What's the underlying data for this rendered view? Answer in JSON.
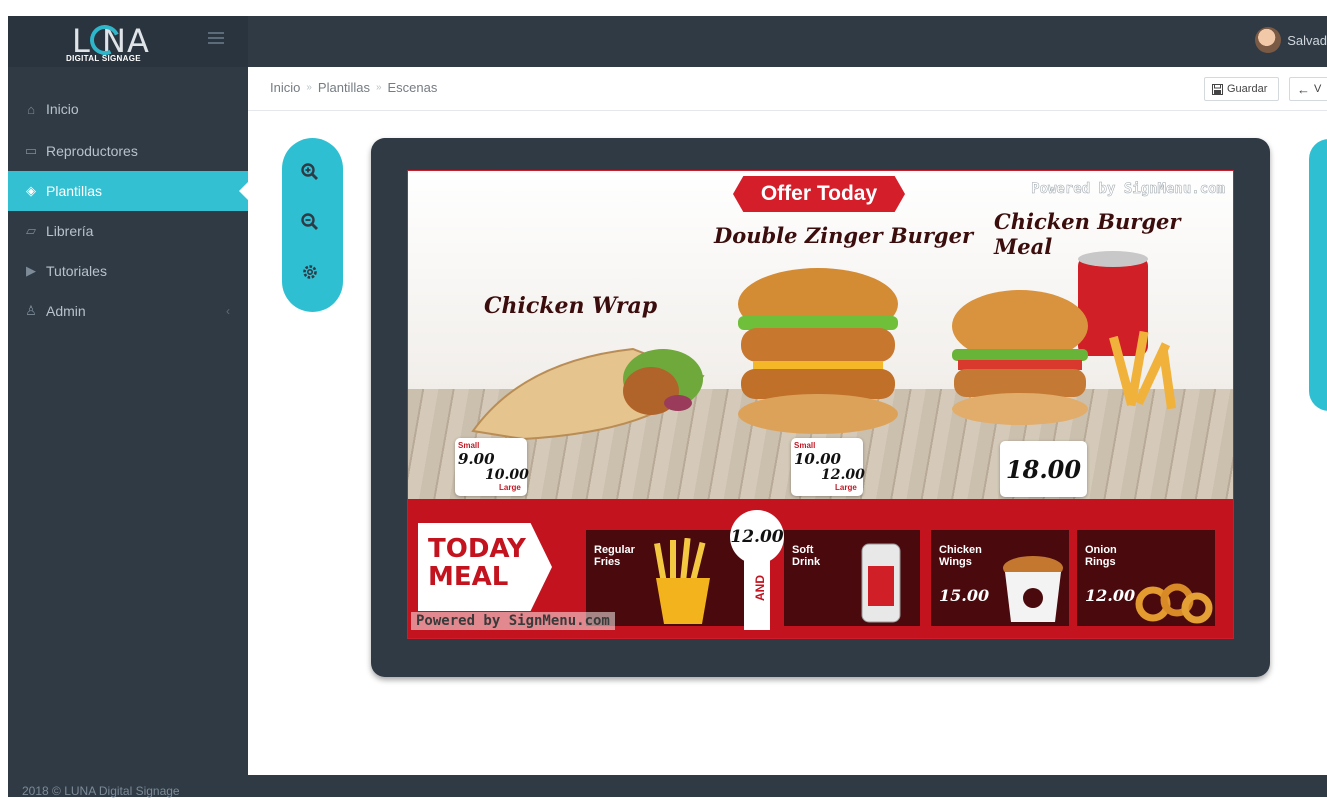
{
  "app": {
    "logo_main": "L NA",
    "logo_sub": "DIGITAL SIGNAGE",
    "user_name": "Salvad",
    "footer": "2018 © LUNA Digital Signage"
  },
  "sidebar": {
    "items": [
      {
        "label": "Inicio",
        "icon": "home-icon"
      },
      {
        "label": "Reproductores",
        "icon": "monitor-icon"
      },
      {
        "label": "Plantillas",
        "icon": "layers-icon"
      },
      {
        "label": "Librería",
        "icon": "folder-icon"
      },
      {
        "label": "Tutoriales",
        "icon": "video-icon"
      },
      {
        "label": "Admin",
        "icon": "user-icon"
      }
    ],
    "admin_chevron": "‹"
  },
  "breadcrumb": {
    "items": [
      "Inicio",
      "Plantillas",
      "Escenas"
    ],
    "separator": "»"
  },
  "toolbar": {
    "save_label": "Guardar",
    "back_label": "V"
  },
  "menu_board": {
    "offer_banner": "Offer Today",
    "powered_top": "Powered by SignMenu.com",
    "powered_bottom": "Powered by SignMenu.com",
    "items": {
      "wrap": {
        "title": "Chicken Wrap",
        "small_label": "Small",
        "small_price": "9.00",
        "large_price": "10.00",
        "large_label": "Large"
      },
      "zinger": {
        "title": "Double Zinger Burger",
        "small_label": "Small",
        "small_price": "10.00",
        "large_price": "12.00",
        "large_label": "Large"
      },
      "meal": {
        "title": "Chicken Burger Meal",
        "price": "18.00"
      }
    },
    "today_meal": {
      "line1": "TODAY",
      "line2": "MEAL",
      "combo_price": "12.00",
      "and_text": "AND",
      "fries": "Regular Fries",
      "drink": "Soft Drink"
    },
    "wings": {
      "name": "Chicken Wings",
      "price": "15.00"
    },
    "rings": {
      "name": "Onion Rings",
      "price": "12.00"
    }
  },
  "colors": {
    "accent": "#32c0d2",
    "dark": "#2f3a45",
    "menu_red": "#c3131f"
  }
}
